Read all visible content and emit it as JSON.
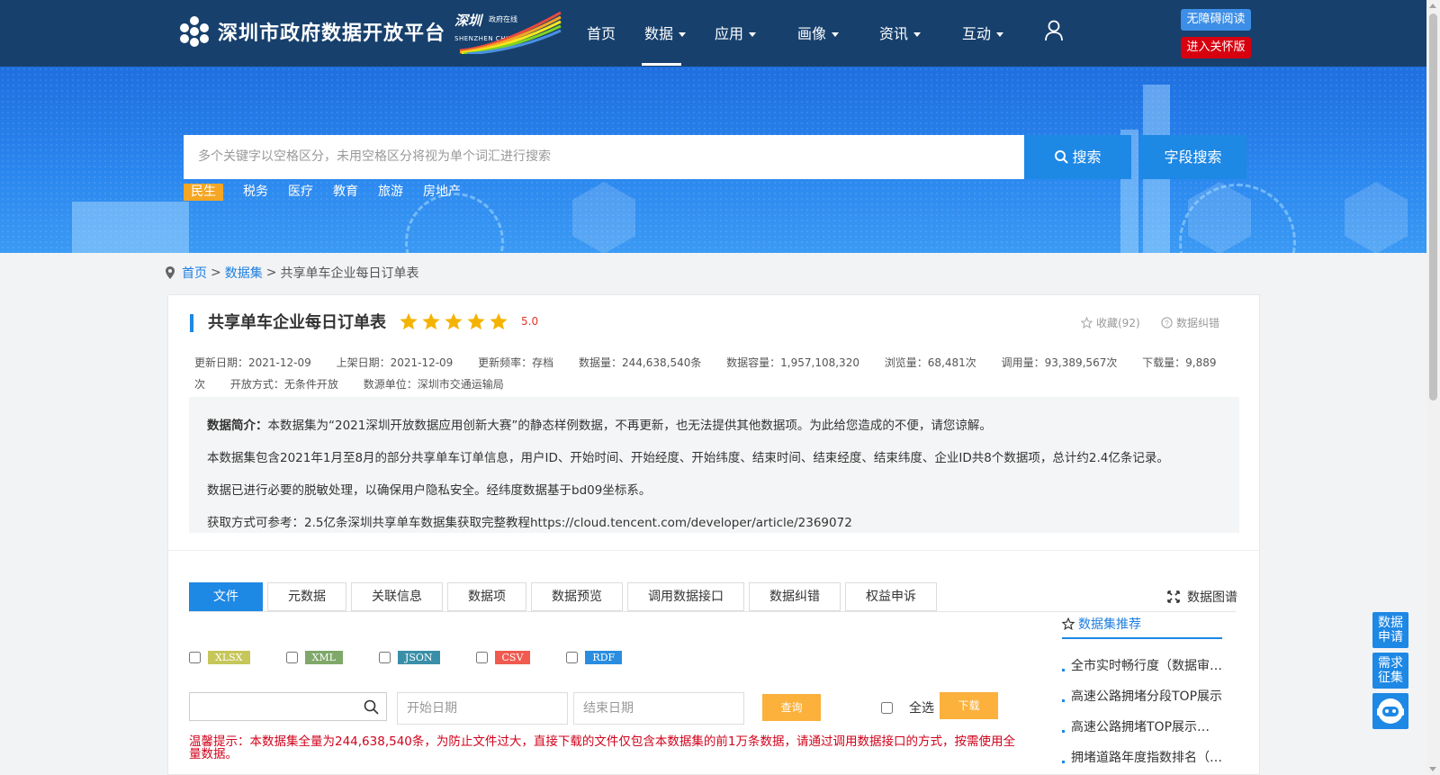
{
  "header": {
    "site_title": "深圳市政府数据开放平台",
    "sz_logo_text": "深圳",
    "sz_logo_tagline": "政府在线",
    "sz_logo_sub": "SHENZHEN CHINA",
    "nav": [
      {
        "label": "首页",
        "has_menu": false
      },
      {
        "label": "数据",
        "has_menu": true
      },
      {
        "label": "应用",
        "has_menu": true
      },
      {
        "label": "画像",
        "has_menu": true
      },
      {
        "label": "资讯",
        "has_menu": true
      },
      {
        "label": "互动",
        "has_menu": true
      }
    ],
    "accessibility_label": "无障碍阅读",
    "care_mode_label": "进入关怀版"
  },
  "search": {
    "placeholder": "多个关键字以空格区分，未用空格区分将视为单个词汇进行搜索",
    "search_label": "搜索",
    "field_search_label": "字段搜索",
    "hot_tags": [
      "民生",
      "税务",
      "医疗",
      "教育",
      "旅游",
      "房地产"
    ]
  },
  "breadcrumb": {
    "home": "首页",
    "datasets": "数据集",
    "current": "共享单车企业每日订单表",
    "sep": ">"
  },
  "dataset": {
    "title": "共享单车企业每日订单表",
    "rating": "5.0",
    "rating_stars": 5,
    "favorite_label": "收藏(92)",
    "correction_label": "数据纠错",
    "meta": [
      "更新日期：2021-12-09",
      "上架日期：2021-12-09",
      "更新频率：存档",
      "数据量：244,638,540条",
      "数据容量：1,957,108,320",
      "浏览量：68,481次",
      "调用量：93,389,567次",
      "下载量：9,889次",
      "开放方式：无条件开放",
      "数源单位：深圳市交通运输局"
    ],
    "intro_label": "数据简介：",
    "intro_lines": [
      "本数据集为“2021深圳开放数据应用创新大赛”的静态样例数据，不再更新，也无法提供其他数据项。为此给您造成的不便，请您谅解。",
      "本数据集包含2021年1月至8月的部分共享单车订单信息，用户ID、开始时间、开始经度、开始纬度、结束时间、结束经度、结束纬度、企业ID共8个数据项，总计约2.4亿条记录。",
      "数据已进行必要的脱敏处理，以确保用户隐私安全。经纬度数据基于bd09坐标系。",
      "获取方式可参考：2.5亿条深圳共享单车数据集获取完整教程https://cloud.tencent.com/developer/article/2369072"
    ]
  },
  "tabs": [
    "文件",
    "元数据",
    "关联信息",
    "数据项",
    "数据预览",
    "调用数据接口",
    "数据纠错",
    "权益申诉"
  ],
  "graph_label": "数据图谱",
  "formats": [
    {
      "label": "XLSX",
      "color": "#c6c65a"
    },
    {
      "label": "XML",
      "color": "#7fa86a"
    },
    {
      "label": "JSON",
      "color": "#3a8fa8"
    },
    {
      "label": "CSV",
      "color": "#f05a4f"
    },
    {
      "label": "RDF",
      "color": "#2a8de0"
    }
  ],
  "filters": {
    "start_date_placeholder": "开始日期",
    "end_date_placeholder": "结束日期",
    "query_label": "查询",
    "select_all_label": "全选",
    "download_label": "下载"
  },
  "warning": "温馨提示：本数据集全量为244,638,540条，为防止文件过大，直接下载的文件仅包含本数据集的前1万条数据，请通过调用数据接口的方式，按需使用全量数据。",
  "recommend": {
    "title": "数据集推荐",
    "items": [
      "全市实时畅行度（数据审核）",
      "高速公路拥堵分段TOP展示",
      "高速公路拥堵TOP展示（数据）",
      "拥堵道路年度指数排名（数据）"
    ]
  },
  "side": {
    "apply_label": "数据申请",
    "demand_label": "需求征集"
  },
  "colors": {
    "nav_bg": "#17406d",
    "primary": "#1e88e5",
    "accent": "#fbb13c",
    "danger": "#d6000f"
  }
}
